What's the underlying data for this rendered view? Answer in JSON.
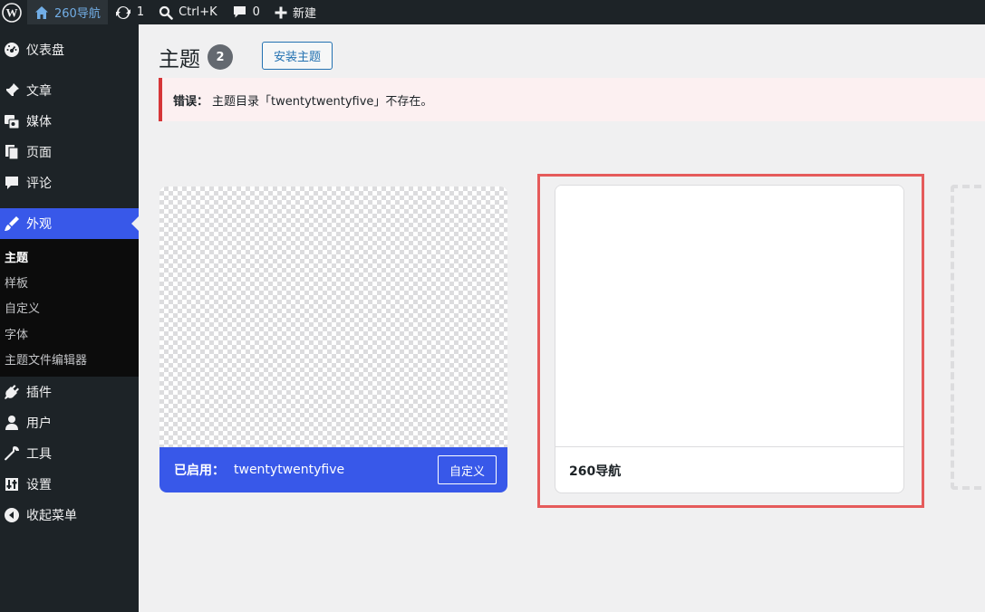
{
  "adminbar": {
    "wp_logo_icon": "wordpress-logo-icon",
    "site_name": "260导航",
    "updates_count": "1",
    "search_shortcut": "Ctrl+K",
    "comments_count": "0",
    "new_label": "新建"
  },
  "sidebar": {
    "items": [
      {
        "label": "仪表盘",
        "icon": "dashboard-icon"
      },
      {
        "label": "文章",
        "icon": "pin-icon"
      },
      {
        "label": "媒体",
        "icon": "media-icon"
      },
      {
        "label": "页面",
        "icon": "pages-icon"
      },
      {
        "label": "评论",
        "icon": "comment-icon"
      },
      {
        "label": "外观",
        "icon": "appearance-icon",
        "current": true
      },
      {
        "label": "插件",
        "icon": "plugins-icon"
      },
      {
        "label": "用户",
        "icon": "users-icon"
      },
      {
        "label": "工具",
        "icon": "tools-icon"
      },
      {
        "label": "设置",
        "icon": "settings-icon"
      },
      {
        "label": "收起菜单",
        "icon": "collapse-icon"
      }
    ],
    "submenu": [
      {
        "label": "主题",
        "current": true
      },
      {
        "label": "样板"
      },
      {
        "label": "自定义"
      },
      {
        "label": "字体"
      },
      {
        "label": "主题文件编辑器"
      }
    ]
  },
  "main": {
    "title": "主题",
    "theme_count": "2",
    "install_button": "安装主题",
    "notice": {
      "prefix": "错误：",
      "message": "主题目录「twentytwentyfive」不存在。"
    },
    "active_theme": {
      "label": "已启用：",
      "name": "twentytwentyfive",
      "customize_button": "自定义"
    },
    "second_theme": {
      "name": "260导航"
    }
  },
  "colors": {
    "accent": "#3858e9",
    "adminbar_bg": "#1d2327",
    "error": "#d63638",
    "highlight": "#e55b5b"
  }
}
